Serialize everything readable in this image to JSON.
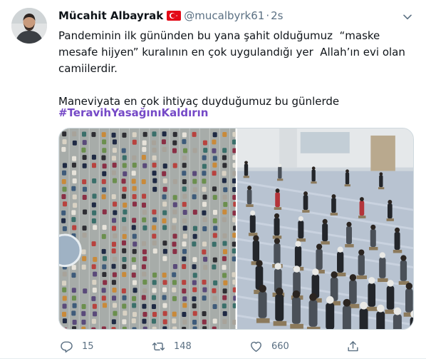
{
  "tweet": {
    "author_name": "Mücahit Albayrak",
    "handle": "@mucalbyrk61",
    "separator": "·",
    "time": "2s",
    "text": "Pandeminin ilk gününden bu yana şahit olduğumuz  “maske\nmesafe hijyen” kuralının en çok uygulandığı yer  Allah’ın evi olan\ncamiilerdir.\n\nManeviyata en çok ihtiyaç duyduğumuz bu günlerde",
    "hashtag": "#TeravihYasağınıKaldırın"
  },
  "icons": {
    "flag": "turkey-flag-icon",
    "more": "more-options-icon",
    "reply": "reply-icon",
    "retweet": "retweet-icon",
    "like": "heart-icon",
    "share": "share-icon"
  },
  "actions": {
    "reply_count": "15",
    "retweet_count": "148",
    "like_count": "660"
  },
  "colors": {
    "hashtag": "#7549c7",
    "muted": "#5b7083",
    "flag_red": "#e30a17"
  }
}
